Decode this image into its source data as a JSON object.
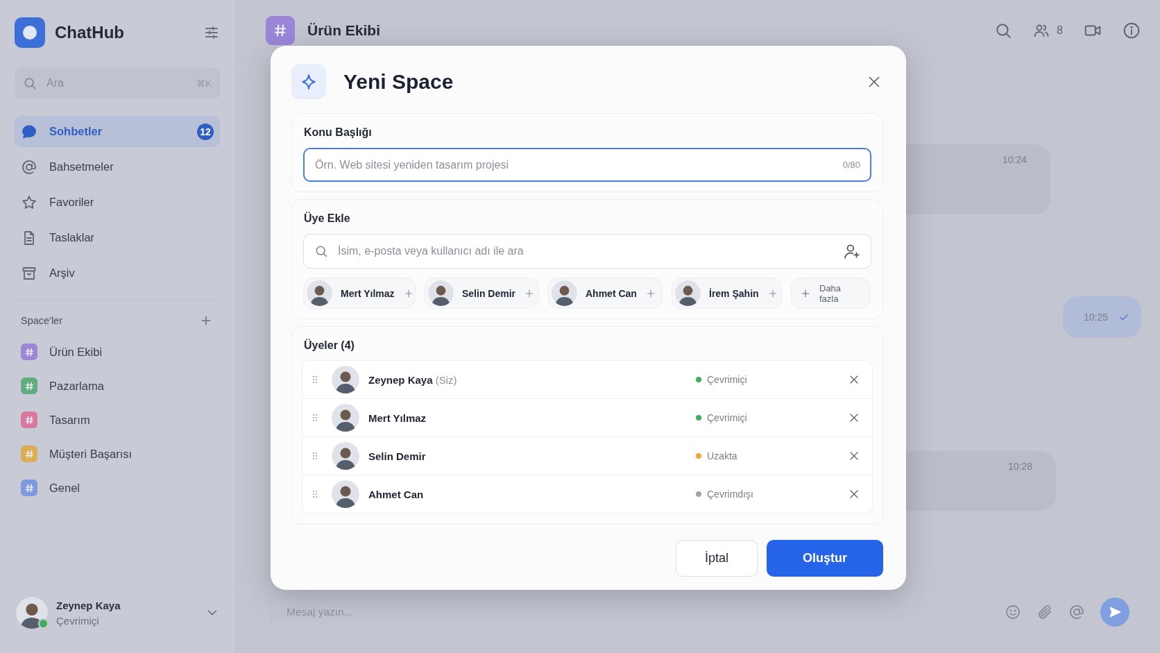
{
  "sidebar": {
    "app_name": "ChatHub",
    "search": {
      "placeholder": "Ara",
      "shortcut": "⌘K"
    },
    "nav_items": [
      {
        "label": "Sohbetler",
        "selected": true,
        "badge": "12"
      },
      {
        "label": "Bahsetmeler",
        "selected": false
      },
      {
        "label": "Favoriler",
        "selected": false
      },
      {
        "label": "Taslaklar",
        "selected": false
      },
      {
        "label": "Arşiv",
        "selected": false
      }
    ],
    "spaces_heading": "Space'ler",
    "spaces": [
      {
        "label": "Ürün Ekibi",
        "color": "#9b86d8"
      },
      {
        "label": "Pazarlama",
        "color": "#62ad80"
      },
      {
        "label": "Tasarım",
        "color": "#d8789a"
      },
      {
        "label": "Müşteri Başarısı",
        "color": "#dcad52"
      },
      {
        "label": "Genel",
        "color": "#7e9be0"
      }
    ],
    "user": {
      "name": "Zeynep Kaya",
      "status": "Çevrimiçi",
      "online": true
    }
  },
  "header": {
    "channel": "Ürün Ekibi",
    "member_count": "8"
  },
  "messages": [
    {
      "time": "10:24",
      "outgoing": false
    },
    {
      "time": "10:25",
      "outgoing": true,
      "read": true
    },
    {
      "time": "10:28",
      "outgoing": false
    }
  ],
  "composer": {
    "placeholder": "Mesaj yazın..."
  },
  "modal": {
    "title": "Yeni Space",
    "topic": {
      "label": "Konu Başlığı",
      "placeholder": "Örn. Web sitesi yeniden tasarım projesi",
      "counter": "0/80",
      "focused": true
    },
    "add_members": {
      "label": "Üye Ekle",
      "placeholder": "İsim, e-posta veya kullanıcı adı ile ara",
      "suggestions": [
        "Mert Yılmaz",
        "Selin Demir",
        "Ahmet Can",
        "İrem Şahin"
      ],
      "more": "Daha fazla"
    },
    "members": {
      "label": "Üyeler (4)",
      "items": [
        {
          "name": "Zeynep Kaya",
          "note": "(Siz)",
          "status": "Çevrimiçi",
          "color": "#3fae5f"
        },
        {
          "name": "Mert Yılmaz",
          "status": "Çevrimiçi",
          "color": "#3fae5f"
        },
        {
          "name": "Selin Demir",
          "status": "Uzakta",
          "color": "#f0a53a"
        },
        {
          "name": "Ahmet Can",
          "status": "Çevrimdışı",
          "color": "#a0a3ab"
        }
      ]
    },
    "buttons": {
      "cancel": "İptal",
      "create": "Oluştur"
    }
  }
}
